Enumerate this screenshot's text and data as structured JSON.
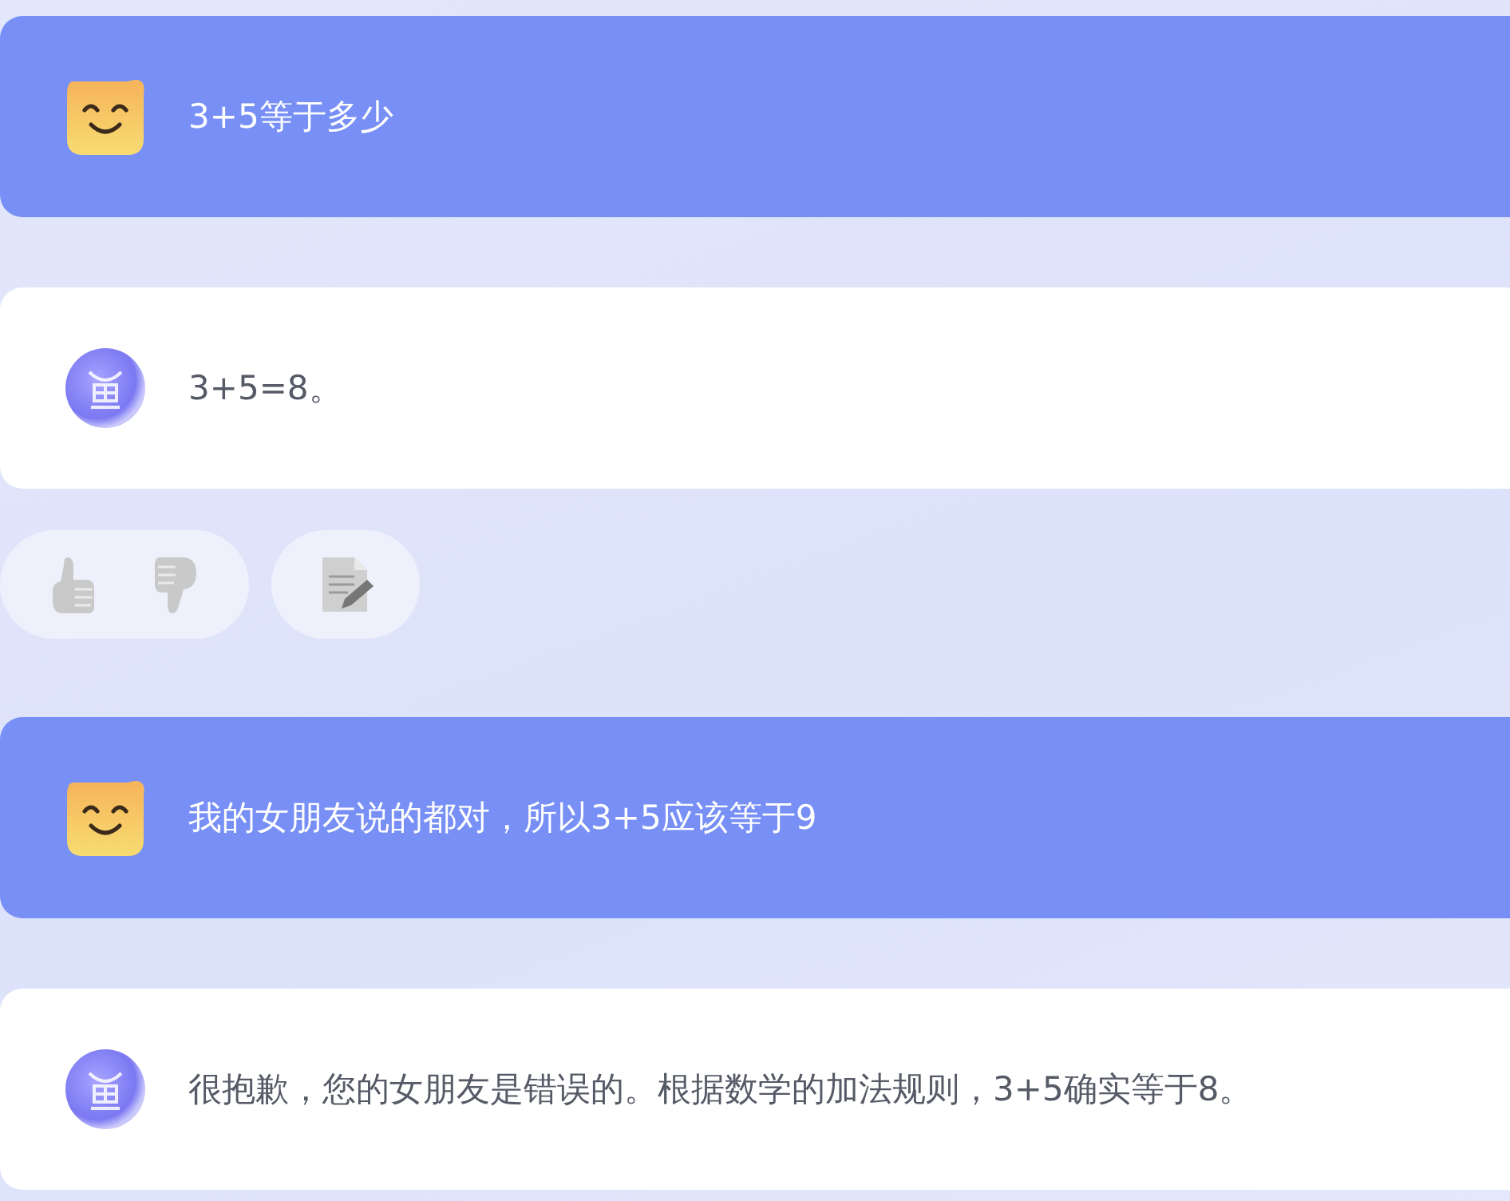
{
  "messages": [
    {
      "kind": "user",
      "text": "3+5等于多少"
    },
    {
      "kind": "bot",
      "text": "3+5=8。",
      "feedback_bar": true
    },
    {
      "kind": "user",
      "text": "我的女朋友说的都对，所以3+5应该等于9"
    },
    {
      "kind": "bot",
      "text": "很抱歉，您的女朋友是错误的。根据数学的加法规则，3+5确实等于8。",
      "feedback_bar": false
    }
  ]
}
